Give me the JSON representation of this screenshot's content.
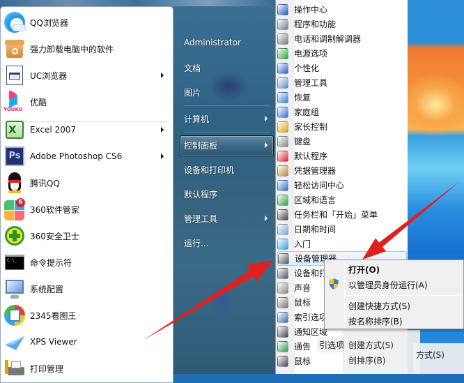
{
  "left_panel": {
    "programs": [
      {
        "label": "QQ浏览器",
        "icon": "qq-browser-icon",
        "has_submenu": false
      },
      {
        "label": "强力卸载电脑中的软件",
        "icon": "uninstaller-icon",
        "has_submenu": false
      },
      {
        "label": "UC浏览器",
        "icon": "uc-browser-icon",
        "has_submenu": true
      },
      {
        "label": "优酷",
        "icon": "youku-icon",
        "has_submenu": false
      },
      {
        "label": "Excel 2007",
        "icon": "excel-icon",
        "has_submenu": true
      },
      {
        "label": "Adobe Photoshop CS6",
        "icon": "photoshop-icon",
        "has_submenu": true
      },
      {
        "label": "腾讯QQ",
        "icon": "qq-penguin-icon",
        "has_submenu": false
      },
      {
        "label": "360软件管家",
        "icon": "360-software-manager-icon",
        "has_submenu": false,
        "badge": "6"
      },
      {
        "label": "360安全卫士",
        "icon": "360-security-icon",
        "has_submenu": false
      },
      {
        "label": "命令提示符",
        "icon": "command-prompt-icon",
        "has_submenu": false
      },
      {
        "label": "系统配置",
        "icon": "system-config-icon",
        "has_submenu": false
      },
      {
        "label": "2345看图王",
        "icon": "2345-image-viewer-icon",
        "has_submenu": false
      },
      {
        "label": "XPS Viewer",
        "icon": "xps-viewer-icon",
        "has_submenu": false
      },
      {
        "label": "打印管理",
        "icon": "print-management-icon",
        "has_submenu": false
      }
    ],
    "youku_text": "YOUKU",
    "cmd_text": "C:\\_"
  },
  "right_panel": {
    "items": [
      {
        "label": "Administrator",
        "has_submenu": false
      },
      {
        "label": "文档",
        "has_submenu": false
      },
      {
        "label": "图片",
        "has_submenu": false
      },
      {
        "label": "计算机",
        "has_submenu": true
      },
      {
        "label": "控制面板",
        "has_submenu": true,
        "highlighted": true
      },
      {
        "label": "设备和打印机",
        "has_submenu": false
      },
      {
        "label": "默认程序",
        "has_submenu": false
      },
      {
        "label": "管理工具",
        "has_submenu": true
      },
      {
        "label": "运行...",
        "has_submenu": false
      }
    ]
  },
  "control_panel_menu": {
    "items": [
      {
        "label": "操作中心",
        "icon": "action-center-flag-icon"
      },
      {
        "label": "程序和功能",
        "icon": "programs-features-icon"
      },
      {
        "label": "电话和调制解调器",
        "icon": "phone-modem-icon"
      },
      {
        "label": "电源选项",
        "icon": "power-options-icon"
      },
      {
        "label": "个性化",
        "icon": "personalization-icon"
      },
      {
        "label": "管理工具",
        "icon": "admin-tools-icon"
      },
      {
        "label": "恢复",
        "icon": "recovery-icon"
      },
      {
        "label": "家庭组",
        "icon": "homegroup-icon"
      },
      {
        "label": "家长控制",
        "icon": "parental-controls-icon"
      },
      {
        "label": "键盘",
        "icon": "keyboard-icon"
      },
      {
        "label": "默认程序",
        "icon": "default-programs-icon"
      },
      {
        "label": "凭据管理器",
        "icon": "credential-manager-icon"
      },
      {
        "label": "轻松访问中心",
        "icon": "ease-of-access-icon"
      },
      {
        "label": "区域和语言",
        "icon": "region-language-icon"
      },
      {
        "label": "任务栏和「开始」菜单",
        "icon": "taskbar-start-menu-icon"
      },
      {
        "label": "日期和时间",
        "icon": "date-time-icon"
      },
      {
        "label": "入门",
        "icon": "getting-started-icon"
      },
      {
        "label": "设备管理器",
        "icon": "device-manager-icon",
        "highlighted": true
      },
      {
        "label": "设备和打",
        "icon": "devices-printers-icon"
      },
      {
        "label": "声音",
        "icon": "sound-icon"
      },
      {
        "label": "鼠标",
        "icon": "mouse-icon"
      },
      {
        "label": "索引选项",
        "icon": "indexing-options-icon"
      },
      {
        "label": "通知区域",
        "icon": "notification-area-icon"
      },
      {
        "label": "通告",
        "icon": "speech-icon"
      },
      {
        "label": "鼠标",
        "icon": "monitor-icon"
      }
    ]
  },
  "context_menu": {
    "items": [
      {
        "label": "打开(O)",
        "bold": true
      },
      {
        "label": "以管理员身份运行(A)",
        "icon": "uac-shield-icon"
      },
      {
        "label": "创建快捷方式(S)"
      },
      {
        "label": "按名称排序(B)"
      }
    ],
    "ghost_items": [
      "引选项",
      "创建方式(S)",
      "创排序(B)",
      "方式(S)"
    ]
  },
  "annotation": {
    "arrow_color": "#e0201c"
  }
}
